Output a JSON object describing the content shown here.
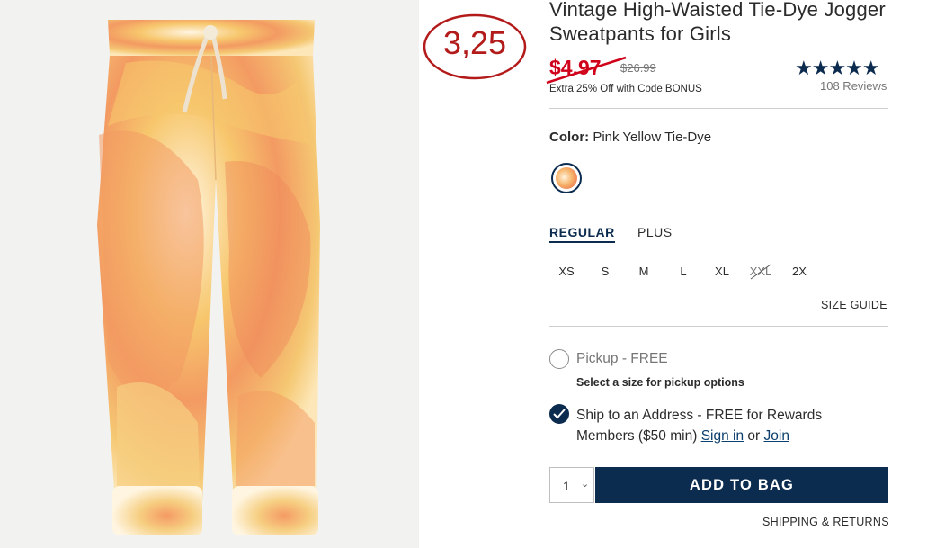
{
  "product": {
    "title": "Vintage High-Waisted Tie-Dye Jogger Sweatpants for Girls",
    "sale_price": "$4.97",
    "original_price": "$26.99",
    "promo": "Extra 25% Off with Code BONUS",
    "stars": "★★★★★",
    "reviews": "108 Reviews",
    "image_alt": "pants-photo"
  },
  "annotation": {
    "text": "3,25",
    "color": "#b31b1b"
  },
  "color": {
    "label": "Color:",
    "value": "Pink Yellow Tie-Dye"
  },
  "fit_tabs": [
    "REGULAR",
    "PLUS"
  ],
  "sizes": [
    {
      "label": "XS",
      "available": true
    },
    {
      "label": "S",
      "available": true
    },
    {
      "label": "M",
      "available": true
    },
    {
      "label": "L",
      "available": true
    },
    {
      "label": "XL",
      "available": true
    },
    {
      "label": "XXL",
      "available": false
    },
    {
      "label": "2X",
      "available": true
    }
  ],
  "size_guide": "SIZE GUIDE",
  "fulfillment": {
    "pickup_label": "Pickup - FREE",
    "pickup_note": "Select a size for pickup options",
    "ship_prefix": "Ship to an Address - FREE for Rewards Members ($50 min)",
    "sign_in": "Sign in",
    "or": "or",
    "join": "Join"
  },
  "cart": {
    "quantity": "1",
    "chevron": "⌄",
    "add_label": "ADD TO BAG"
  },
  "shipping_link": "SHIPPING & RETURNS",
  "colors": {
    "navy": "#0b2b4f",
    "sale_red": "#d0021b"
  }
}
